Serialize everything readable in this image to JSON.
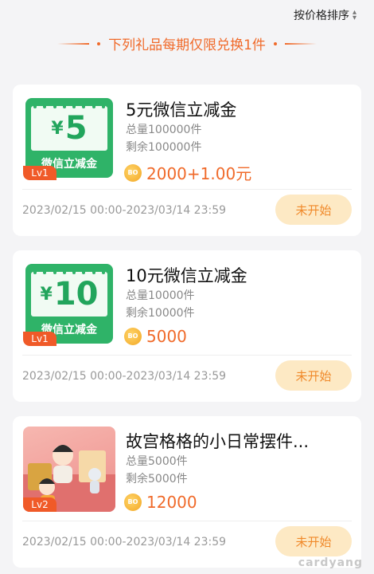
{
  "sort": {
    "label": "按价格排序",
    "icon": "sort-updown-icon"
  },
  "subtitle": "下列礼品每期仅限兑换1件",
  "items": [
    {
      "title": "5元微信立减金",
      "total": "总量100000件",
      "remaining": "剩余100000件",
      "price": "2000+1.00元",
      "coin_text": "BO",
      "period": "2023/02/15 00:00-2023/03/14 23:59",
      "button": "未开始",
      "level": "Lv1",
      "coupon_amount": "5",
      "coupon_yen": "¥",
      "coupon_label": "微信立减金"
    },
    {
      "title": "10元微信立减金",
      "total": "总量10000件",
      "remaining": "剩余10000件",
      "price": "5000",
      "coin_text": "BO",
      "period": "2023/02/15 00:00-2023/03/14 23:59",
      "button": "未开始",
      "level": "Lv1",
      "coupon_amount": "10",
      "coupon_yen": "¥",
      "coupon_label": "微信立减金"
    },
    {
      "title": "故宫格格的小日常摆件...",
      "total": "总量5000件",
      "remaining": "剩余5000件",
      "price": "12000",
      "coin_text": "BO",
      "period": "2023/02/15 00:00-2023/03/14 23:59",
      "button": "未开始",
      "level": "Lv2"
    }
  ],
  "watermark": "cardyang",
  "colors": {
    "accent": "#f06a2a",
    "coupon_green": "#2fb368",
    "button_bg": "#fde9c4"
  }
}
